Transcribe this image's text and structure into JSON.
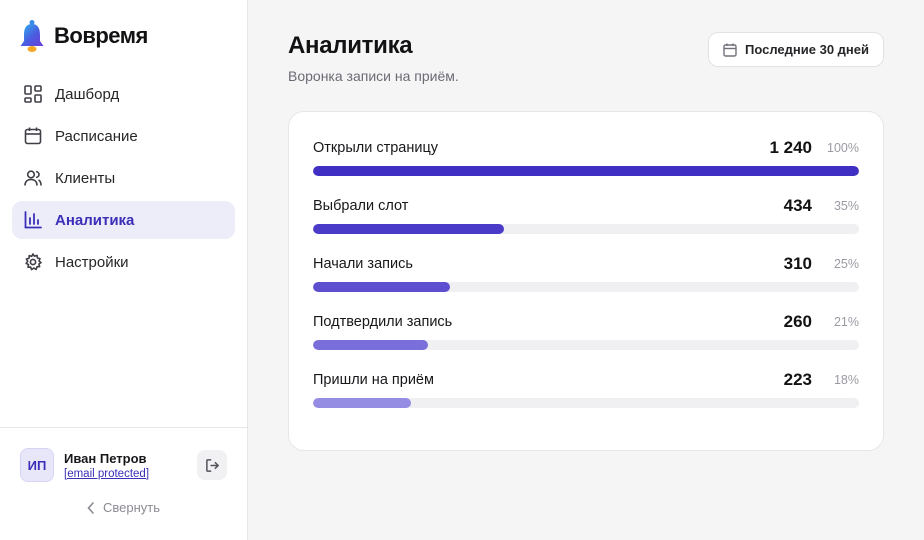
{
  "brand": {
    "name": "Вовремя",
    "icon": "bell-icon"
  },
  "nav": [
    {
      "label": "Дашборд",
      "icon": "dashboard-icon",
      "active": false
    },
    {
      "label": "Расписание",
      "icon": "calendar-icon",
      "active": false
    },
    {
      "label": "Клиенты",
      "icon": "users-icon",
      "active": false
    },
    {
      "label": "Аналитика",
      "icon": "chart-icon",
      "active": true
    },
    {
      "label": "Настройки",
      "icon": "gear-icon",
      "active": false
    }
  ],
  "user": {
    "initials": "ИП",
    "name": "Иван Петров",
    "email": "[email protected]"
  },
  "sidebar": {
    "collapse_label": "Свернуть"
  },
  "page": {
    "title": "Аналитика",
    "subtitle": "Воронка записи на приём.",
    "period_label": "Последние 30 дней"
  },
  "funnel": [
    {
      "label": "Открыли страницу",
      "value": "1 240",
      "percent": "100%",
      "fraction": 1.0,
      "color": "#3f2fc2"
    },
    {
      "label": "Выбрали слот",
      "value": "434",
      "percent": "35%",
      "fraction": 0.35,
      "color": "#4a3bc8"
    },
    {
      "label": "Начали запись",
      "value": "310",
      "percent": "25%",
      "fraction": 0.25,
      "color": "#5d4fd0"
    },
    {
      "label": "Подтвердили запись",
      "value": "260",
      "percent": "21%",
      "fraction": 0.21,
      "color": "#7a6edb"
    },
    {
      "label": "Пришли на приём",
      "value": "223",
      "percent": "18%",
      "fraction": 0.18,
      "color": "#958ce3"
    }
  ],
  "colors": {
    "accent": "#3b2fb8",
    "active_bg": "#ededfa"
  }
}
